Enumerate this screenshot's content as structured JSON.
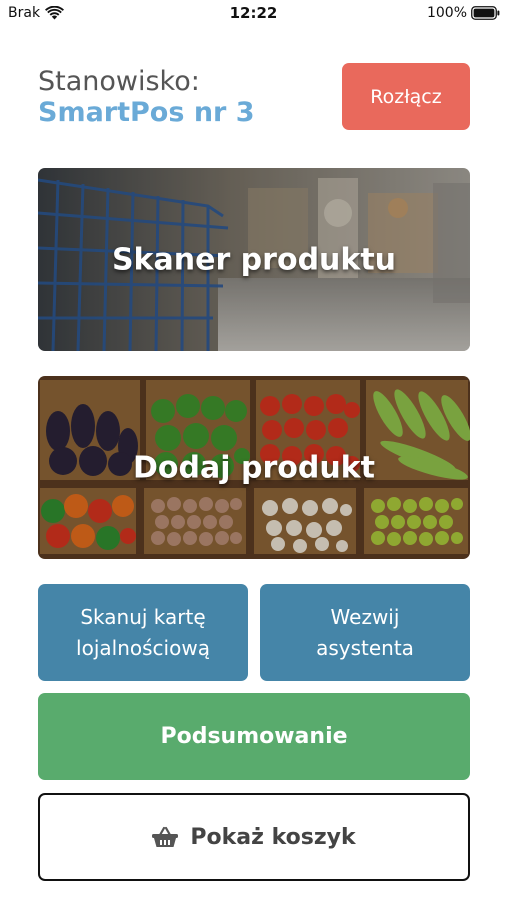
{
  "status_bar": {
    "carrier": "Brak",
    "time": "12:22",
    "battery": "100%",
    "icons": [
      "wifi-icon",
      "battery-icon"
    ]
  },
  "header": {
    "station_label": "Stanowisko:",
    "station_name": "SmartPos nr 3",
    "disconnect_label": "Rozłącz"
  },
  "tiles": {
    "scanner_label": "Skaner produktu",
    "add_product_label": "Dodaj produkt"
  },
  "buttons": {
    "loyalty_line1": "Skanuj kartę",
    "loyalty_line2": "lojalnościową",
    "assistant_line1": "Wezwij",
    "assistant_line2": "asystenta",
    "summary": "Podsumowanie",
    "cart": "Pokaż koszyk",
    "cart_icon": "basket-icon"
  },
  "colors": {
    "accent_blue": "#4585a8",
    "station_name": "#6aaad7",
    "disconnect": "#e9695c",
    "summary": "#59ab6d"
  }
}
